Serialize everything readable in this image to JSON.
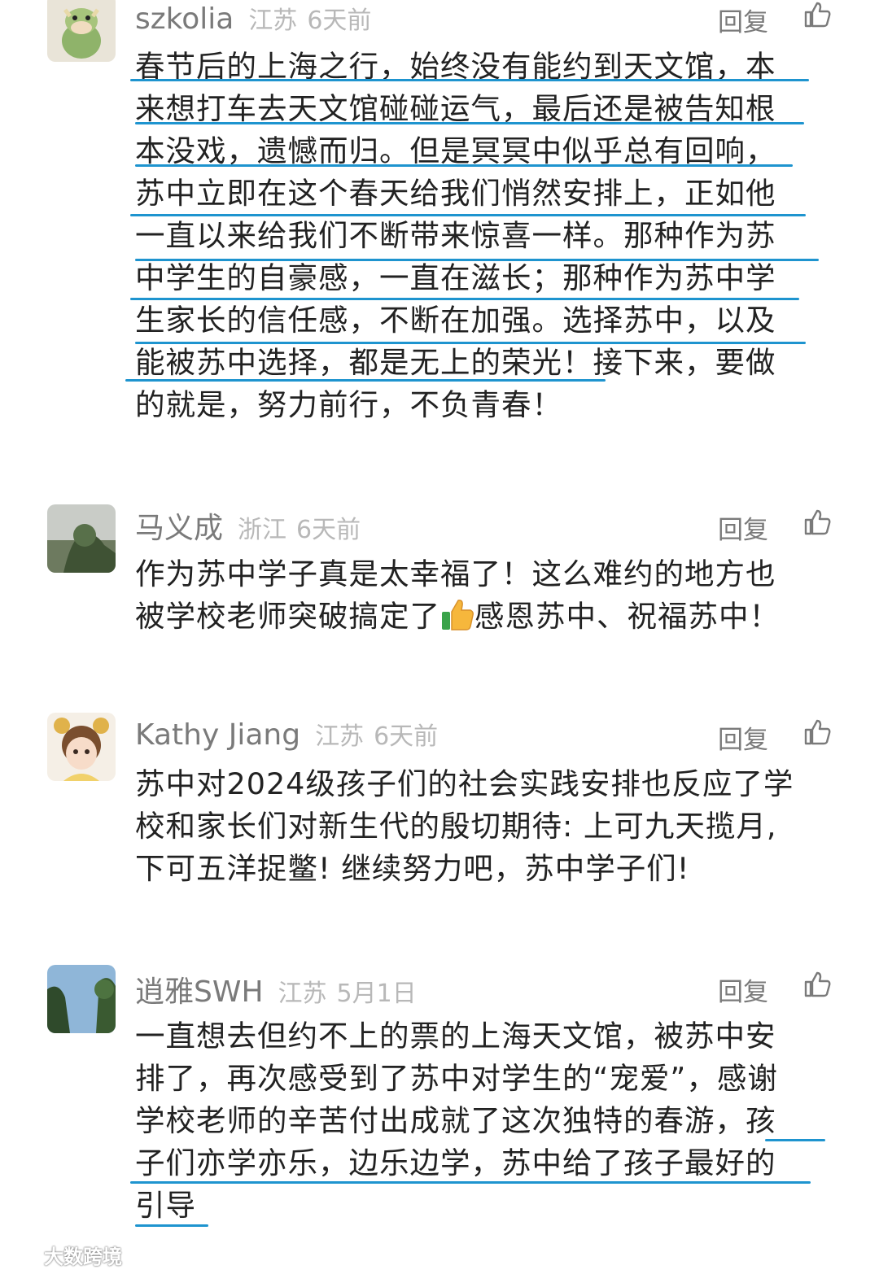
{
  "comments": [
    {
      "username": "szkolia",
      "location": "江苏",
      "time": "6天前",
      "reply_label": "回复",
      "lines": [
        "春节后的上海之行，始终没有能约到天文馆，本",
        "来想打车去天文馆碰碰运气，最后还是被告知根",
        "本没戏，遗憾而归。但是冥冥中似乎总有回响，",
        "苏中立即在这个春天给我们悄然安排上，正如他",
        "一直以来给我们不断带来惊喜一样。那种作为苏",
        "中学生的自豪感，一直在滋长；那种作为苏中学",
        "生家长的信任感，不断在加强。选择苏中，以及",
        "能被苏中选择，都是无上的荣光！接下来，要做",
        "的就是，努力前行，不负青春！"
      ]
    },
    {
      "username": "马义成",
      "location": "浙江",
      "time": "6天前",
      "reply_label": "回复",
      "lines": [
        "作为苏中学子真是太幸福了！这么难约的地方也",
        "被学校老师突破搞定了",
        "感恩苏中、祝福苏中！"
      ],
      "emoji": "thumbs-up"
    },
    {
      "username": "Kathy Jiang",
      "location": "江苏",
      "time": "6天前",
      "reply_label": "回复",
      "lines": [
        "苏中对2024级孩子们的社会实践安排也反应了学",
        "校和家长们对新生代的殷切期待: 上可九天揽月,",
        "下可五洋捉鳖! 继续努力吧，苏中学子们!"
      ]
    },
    {
      "username": "逍雅SWH",
      "location": "江苏",
      "time": "5月1日",
      "reply_label": "回复",
      "lines": [
        "一直想去但约不上的票的上海天文馆，被苏中安",
        "排了，再次感受到了苏中对学生的“宠爱”，感谢",
        "学校老师的辛苦付出成就了这次独特的春游，孩",
        "子们亦学亦乐，边乐边学，苏中给了孩子最好的",
        "引导"
      ]
    }
  ],
  "watermark": "大数跨境",
  "colors": {
    "underline": "#1e94cf",
    "username": "#7a7a7a",
    "meta": "#b8b8b8",
    "text": "#222222"
  }
}
